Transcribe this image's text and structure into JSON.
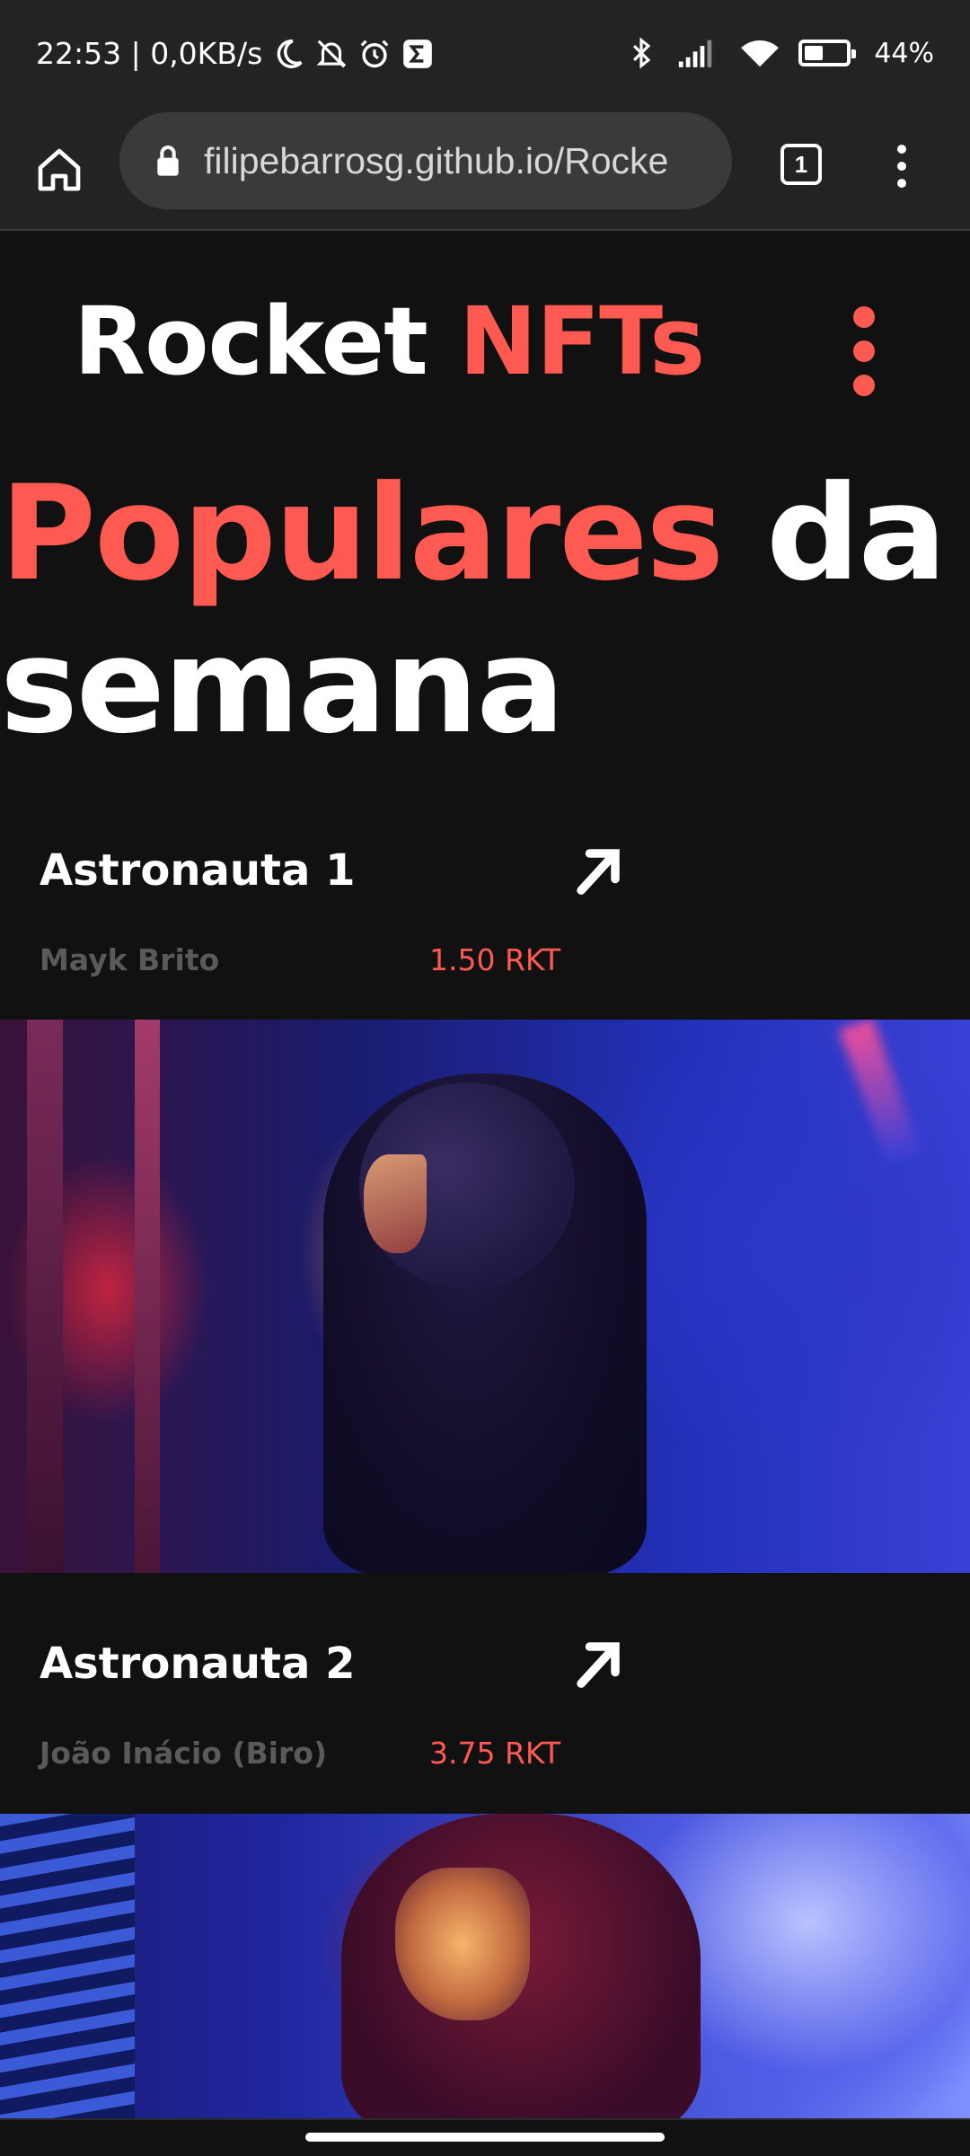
{
  "status_bar": {
    "time": "22:53 | 0,0KB/s",
    "battery": "44%",
    "battery_level": 0.44,
    "icons": [
      "moon-icon",
      "dnd-bell-off-icon",
      "alarm-icon",
      "sigma-app-icon",
      "bluetooth-icon",
      "signal-icon",
      "wifi-icon",
      "battery-icon"
    ]
  },
  "browser": {
    "url": "filipebarrosg.github.io/Rocke",
    "tab_count": "1"
  },
  "header": {
    "logo_word1": "Rocket",
    "logo_word2": "NFTs"
  },
  "hero": {
    "accent_word": "Populares",
    "rest_line1": "da",
    "line2": "semana"
  },
  "cards": [
    {
      "title": "Astronauta 1",
      "author": "Mayk Brito",
      "price": "1.50 RKT"
    },
    {
      "title": "Astronauta 2",
      "author": "João Inácio (Biro)",
      "price": "3.75 RKT"
    }
  ],
  "colors": {
    "accent": "#ff5a52",
    "background": "#111111",
    "toolbar": "#232323"
  }
}
